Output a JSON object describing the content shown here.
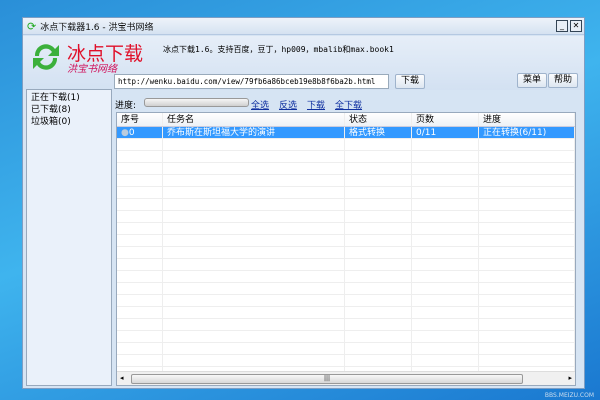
{
  "window": {
    "title": "冰点下载器1.6 - 洪宝书网络",
    "minimize": "_",
    "close": "✕"
  },
  "header": {
    "brand": "冰点下载",
    "sub_brand": "洪宝书网络",
    "info": "冰点下载1.6。支持百度，豆丁，hp009，mbalib和max.book1",
    "menu_button": "菜单",
    "help_button": "帮助"
  },
  "url_input": {
    "value": "http://wenku.baidu.com/view/79fb6a86bceb19e8b8f6ba2b.html"
  },
  "download_button": "下载",
  "progress": {
    "label": "进度:",
    "value": 0
  },
  "links": [
    "全选",
    "反选",
    "下载",
    "全下载"
  ],
  "sidebar": {
    "items": [
      {
        "label": "正在下载(1)"
      },
      {
        "label": "已下载(8)"
      },
      {
        "label": "垃圾箱(0)"
      }
    ]
  },
  "table": {
    "headers": [
      "序号",
      "任务名",
      "状态",
      "页数",
      "进度"
    ],
    "rows": [
      [
        "0",
        "乔布斯在斯坦福大学的演讲",
        "格式转换",
        "0/11",
        "正在转换(6/11)"
      ]
    ]
  },
  "scrollbar": {
    "grip": "|||"
  },
  "watermark": "BBS.MEIZU.COM",
  "colors": {
    "selection": "#3399ff",
    "brand": "#e0102a"
  }
}
